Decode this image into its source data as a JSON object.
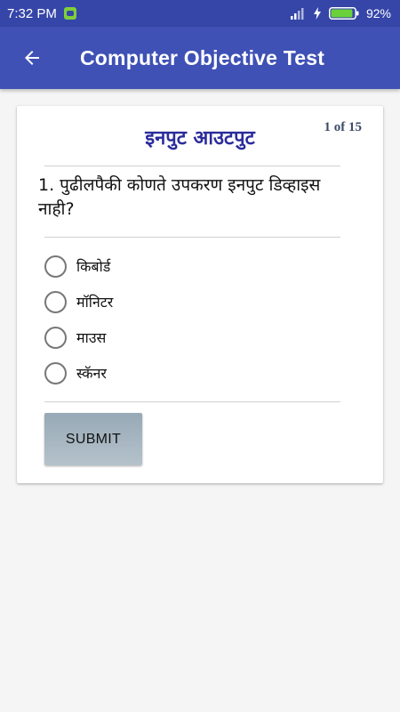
{
  "status_bar": {
    "time": "7:32 PM",
    "battery_percent": "92%",
    "battery_level": 0.92,
    "icons": [
      "app-notification-icon",
      "signal-icon",
      "charging-bolt-icon",
      "battery-icon"
    ]
  },
  "app_bar": {
    "title": "Computer Objective Test",
    "back_icon": "arrow-left-icon"
  },
  "quiz": {
    "topic": "इनपुट आउटपुट",
    "progress": "1 of 15",
    "question": "1. पुढीलपैकी कोणते उपकरण इनपुट डिव्हाइस नाही?",
    "options": [
      "किबोर्ड",
      "मॉनिटर",
      "माउस",
      "स्कॅनर"
    ],
    "submit_label": "SUBMIT"
  },
  "colors": {
    "status_bar": "#3546a8",
    "app_bar": "#3f51b5",
    "topic_title": "#2b2c9c",
    "submit_button": "#a7b6c1",
    "background": "#f5f5f5"
  }
}
